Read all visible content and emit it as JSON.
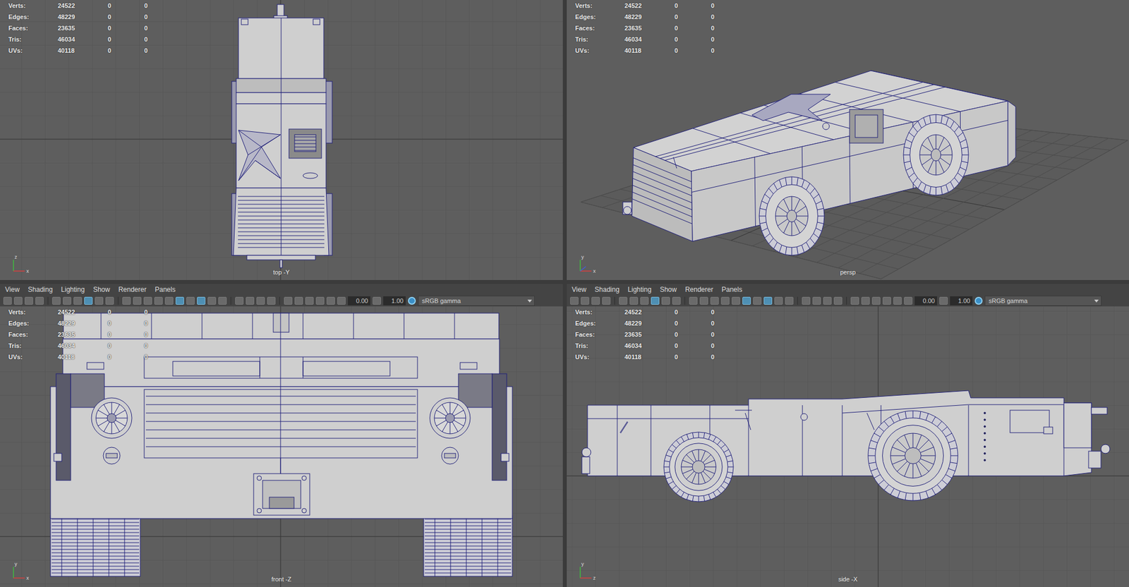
{
  "viewports": [
    {
      "label": "top -Y",
      "kind": "top",
      "axis": [
        "z",
        "x"
      ],
      "hud": [
        {
          "label": "Verts:",
          "values": [
            "24522",
            "0",
            "0"
          ]
        },
        {
          "label": "Edges:",
          "values": [
            "48229",
            "0",
            "0"
          ]
        },
        {
          "label": "Faces:",
          "values": [
            "23635",
            "0",
            "0"
          ]
        },
        {
          "label": "Tris:",
          "values": [
            "46034",
            "0",
            "0"
          ]
        },
        {
          "label": "UVs:",
          "values": [
            "40118",
            "0",
            "0"
          ]
        }
      ]
    },
    {
      "label": "persp",
      "kind": "persp",
      "axis": [
        "y",
        "x"
      ],
      "hud": [
        {
          "label": "Verts:",
          "values": [
            "24522",
            "0",
            "0"
          ]
        },
        {
          "label": "Edges:",
          "values": [
            "48229",
            "0",
            "0"
          ]
        },
        {
          "label": "Faces:",
          "values": [
            "23635",
            "0",
            "0"
          ]
        },
        {
          "label": "Tris:",
          "values": [
            "46034",
            "0",
            "0"
          ]
        },
        {
          "label": "UVs:",
          "values": [
            "40118",
            "0",
            "0"
          ]
        }
      ]
    },
    {
      "label": "front -Z",
      "kind": "front",
      "axis": [
        "y",
        "x"
      ],
      "menus": [
        "View",
        "Shading",
        "Lighting",
        "Show",
        "Renderer",
        "Panels"
      ],
      "toolbar": {
        "buttons": [
          {
            "on": false
          },
          {
            "on": false
          },
          {
            "on": false
          },
          {
            "on": false
          },
          {
            "on": false
          },
          {
            "on": false
          },
          {
            "on": false
          },
          {
            "on": true
          },
          {
            "on": false
          },
          {
            "on": false
          },
          {
            "on": false
          },
          {
            "on": false
          },
          {
            "on": false
          },
          {
            "on": false
          },
          {
            "on": false
          },
          {
            "on": true
          },
          {
            "on": false
          },
          {
            "on": true
          },
          {
            "on": false
          },
          {
            "on": false
          },
          {
            "on": false
          },
          {
            "on": false
          },
          {
            "on": false
          },
          {
            "on": false
          },
          {
            "on": false
          },
          {
            "on": false
          },
          {
            "on": false
          },
          {
            "on": false
          },
          {
            "on": false
          }
        ],
        "exposure": "0.00",
        "gamma": "1.00",
        "colorspace": "sRGB gamma"
      },
      "hud": [
        {
          "label": "Verts:",
          "values": [
            "24522",
            "0",
            "0"
          ]
        },
        {
          "label": "Edges:",
          "values": [
            "48229",
            "0",
            "0"
          ]
        },
        {
          "label": "Faces:",
          "values": [
            "23635",
            "0",
            "0"
          ]
        },
        {
          "label": "Tris:",
          "values": [
            "46034",
            "0",
            "0"
          ]
        },
        {
          "label": "UVs:",
          "values": [
            "40118",
            "0",
            "0"
          ]
        }
      ]
    },
    {
      "label": "side -X",
      "kind": "side",
      "axis": [
        "y",
        "z"
      ],
      "menus": [
        "View",
        "Shading",
        "Lighting",
        "Show",
        "Renderer",
        "Panels"
      ],
      "toolbar": {
        "buttons": [
          {
            "on": false
          },
          {
            "on": false
          },
          {
            "on": false
          },
          {
            "on": false
          },
          {
            "on": false
          },
          {
            "on": false
          },
          {
            "on": false
          },
          {
            "on": true
          },
          {
            "on": false
          },
          {
            "on": false
          },
          {
            "on": false
          },
          {
            "on": false
          },
          {
            "on": false
          },
          {
            "on": false
          },
          {
            "on": false
          },
          {
            "on": true
          },
          {
            "on": false
          },
          {
            "on": true
          },
          {
            "on": false
          },
          {
            "on": false
          },
          {
            "on": false
          },
          {
            "on": false
          },
          {
            "on": false
          },
          {
            "on": false
          },
          {
            "on": false
          },
          {
            "on": false
          },
          {
            "on": false
          },
          {
            "on": false
          },
          {
            "on": false
          }
        ],
        "exposure": "0.00",
        "gamma": "1.00",
        "colorspace": "sRGB gamma"
      },
      "hud": [
        {
          "label": "Verts:",
          "values": [
            "24522",
            "0",
            "0"
          ]
        },
        {
          "label": "Edges:",
          "values": [
            "48229",
            "0",
            "0"
          ]
        },
        {
          "label": "Faces:",
          "values": [
            "23635",
            "0",
            "0"
          ]
        },
        {
          "label": "Tris:",
          "values": [
            "46034",
            "0",
            "0"
          ]
        },
        {
          "label": "UVs:",
          "values": [
            "40118",
            "0",
            "0"
          ]
        }
      ]
    }
  ]
}
